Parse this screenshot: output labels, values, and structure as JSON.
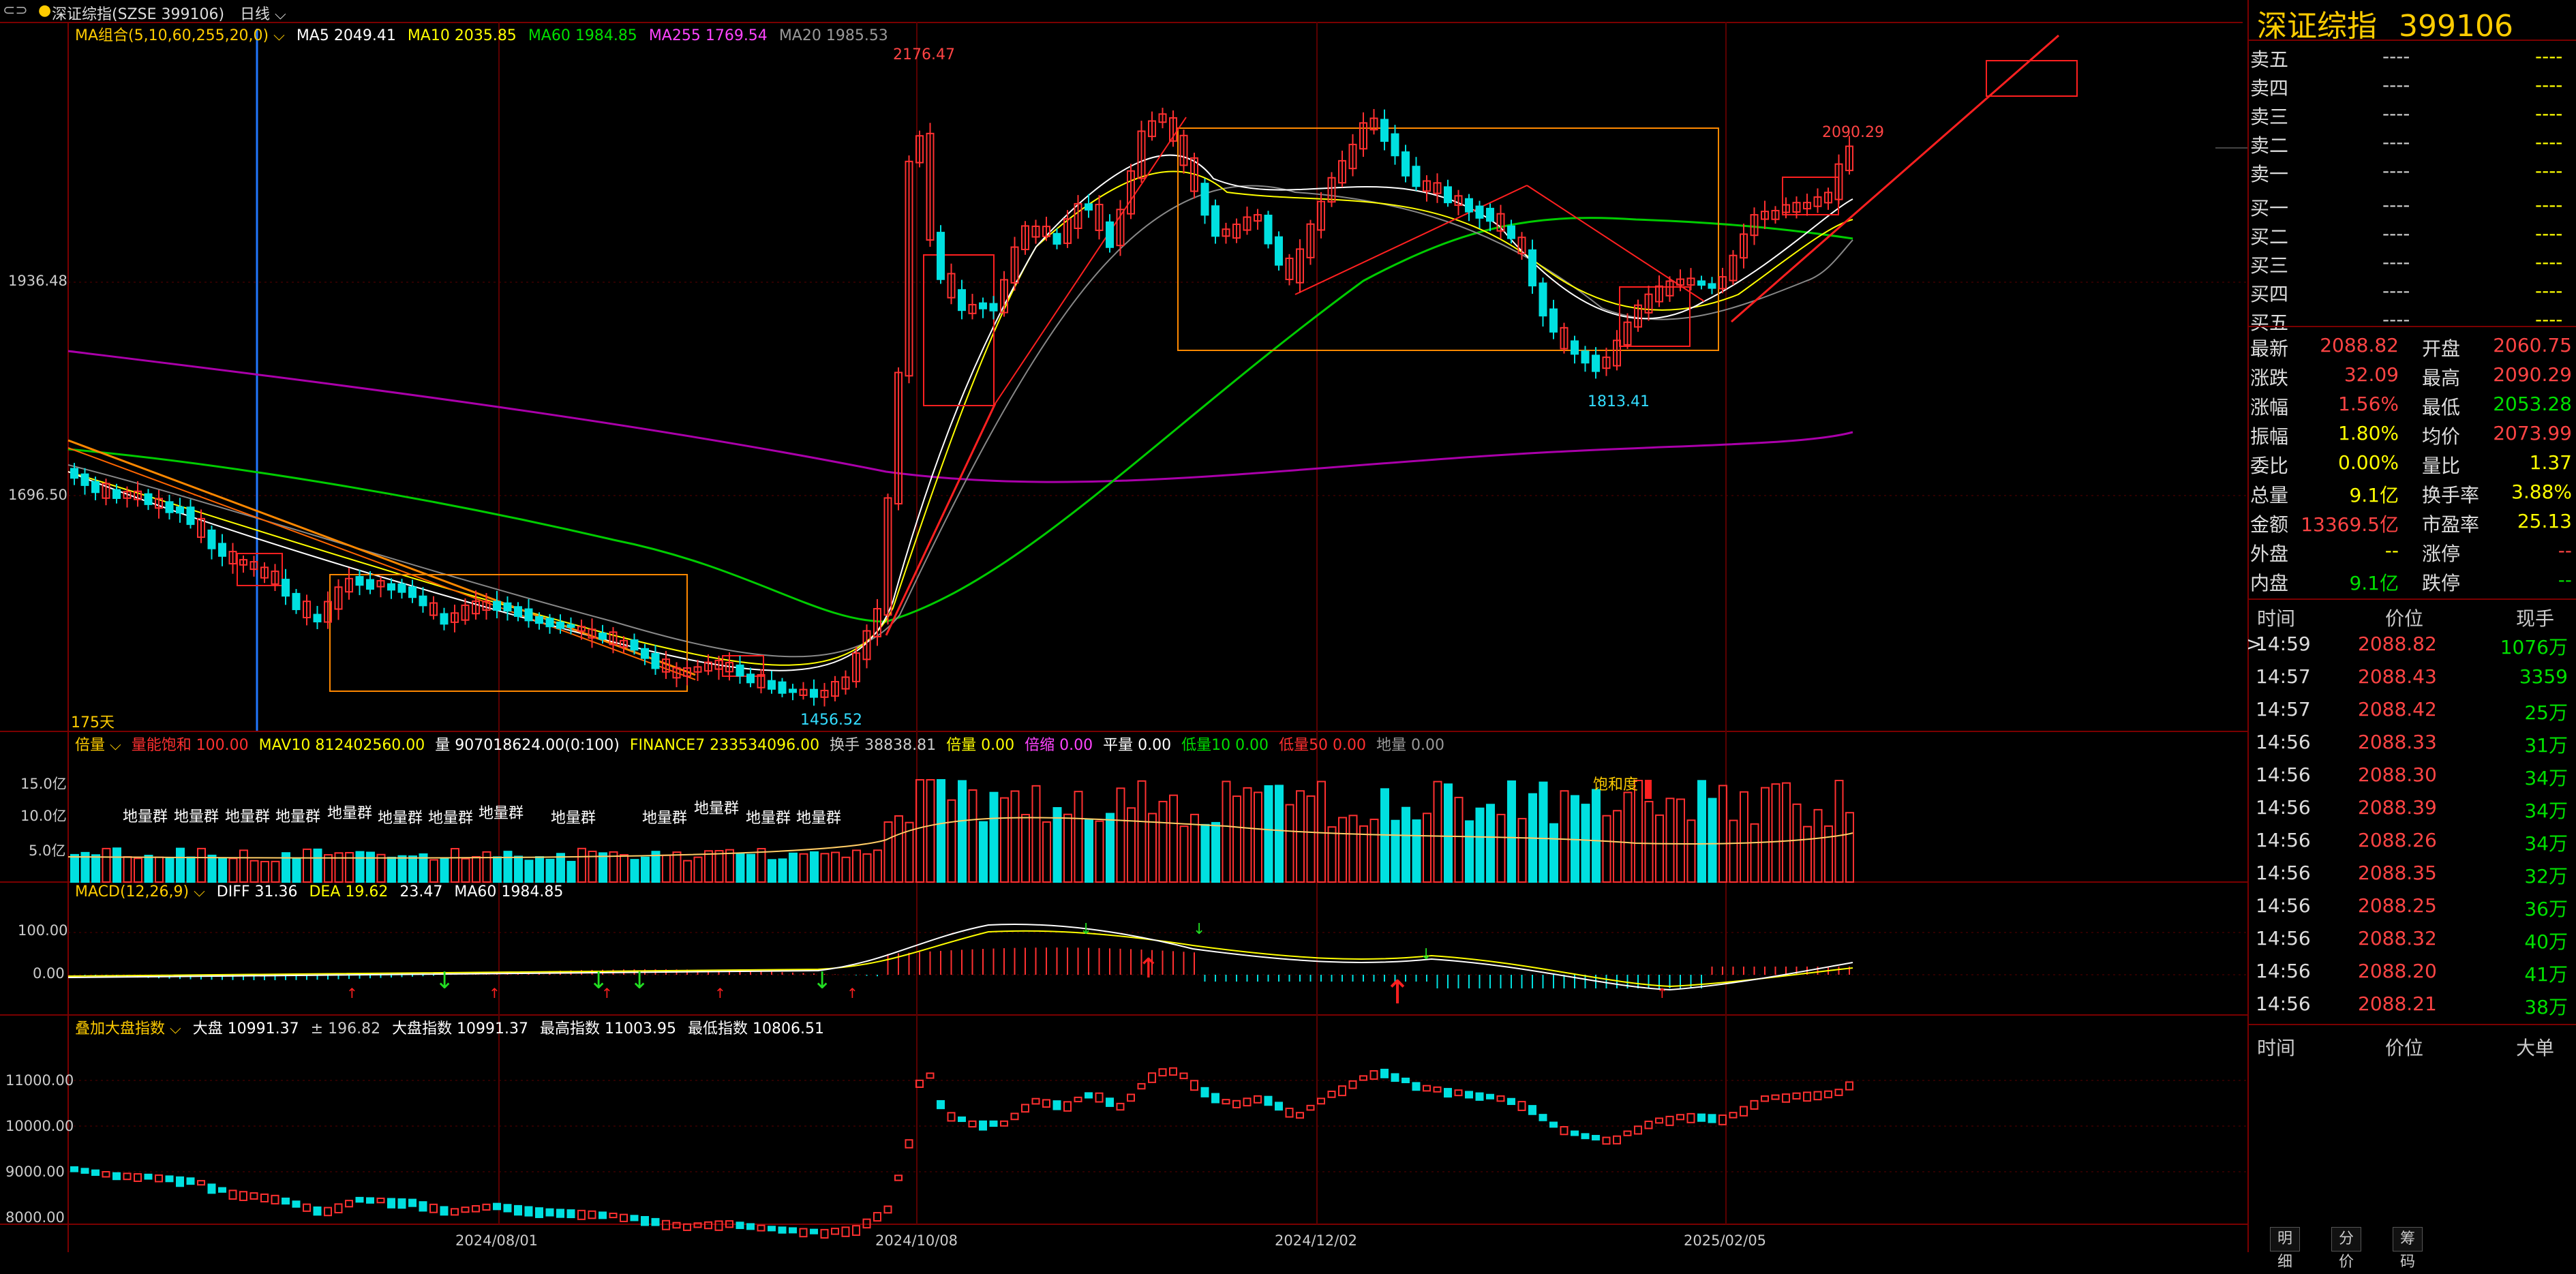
{
  "window": {
    "title": "深证综指(SZSE  399106)",
    "period": "日线"
  },
  "main_legend": {
    "ma_group": "MA组合(5,10,60,255,20,0)",
    "ma5": "MA5 2049.41",
    "ma10": "MA10 2035.85",
    "ma60": "MA60 1984.85",
    "ma255": "MA255 1769.54",
    "ma20": "MA20 1985.53"
  },
  "main_axis": {
    "y1": "1936.48",
    "y2": "1696.50"
  },
  "main_annotations": {
    "high_label": "2176.47",
    "low_label": "1456.52",
    "mid_low_label": "1813.41",
    "last_high_label": "2090.29",
    "days_label": "175天"
  },
  "volume_legend": {
    "name": "倍量",
    "sat": "量能饱和 100.00",
    "mav10": "MAV10 812402560.00",
    "vol": "量 907018624.00(0:100)",
    "finance": "FINANCE7 233534096.00",
    "turnover": "换手 38838.81",
    "double": "倍量 0.00",
    "shrink": "倍缩 0.00",
    "flat": "平量 0.00",
    "low10": "低量10 0.00",
    "low50": "低量50 0.00",
    "ground": "地量 0.00"
  },
  "volume_axis": {
    "y1": "15.0亿",
    "y2": "10.0亿",
    "y3": "5.0亿"
  },
  "volume_annotations": {
    "sat_label": "饱和度",
    "ground_groups": [
      "地量群",
      "地量群",
      "地量群",
      "地量群",
      "地量群",
      "地量群",
      "地量群",
      "地量群",
      "地量群",
      "地量群",
      "地量群",
      "地量群",
      "地量群",
      "地量群"
    ]
  },
  "macd_legend": {
    "name": "MACD(12,26,9)",
    "diff": "DIFF 31.36",
    "dea": "DEA 19.62",
    "macd": "23.47",
    "ma60": "MA60 1984.85"
  },
  "macd_axis": {
    "y1": "100.00",
    "y2": "0.00"
  },
  "index_legend": {
    "name": "叠加大盘指数",
    "dp": "大盘 10991.37",
    "chg": "± 196.82",
    "idx": "大盘指数 10991.37",
    "hi": "最高指数 11003.95",
    "lo": "最低指数 10806.51"
  },
  "index_axis": {
    "y1": "11000.00",
    "y2": "10000.00",
    "y3": "9000.00",
    "y4": "8000.00"
  },
  "x_axis": {
    "d1": "2024/08/01",
    "d2": "2024/10/08",
    "d3": "2024/12/02",
    "d4": "2025/02/05"
  },
  "quote": {
    "name": "深证综指",
    "code": "399106",
    "orderbook": [
      {
        "label": "卖五",
        "price": "----",
        "vol": "----"
      },
      {
        "label": "卖四",
        "price": "----",
        "vol": "----"
      },
      {
        "label": "卖三",
        "price": "----",
        "vol": "----"
      },
      {
        "label": "卖二",
        "price": "----",
        "vol": "----"
      },
      {
        "label": "卖一",
        "price": "----",
        "vol": "----"
      },
      {
        "label": "买一",
        "price": "----",
        "vol": "----"
      },
      {
        "label": "买二",
        "price": "----",
        "vol": "----"
      },
      {
        "label": "买三",
        "price": "----",
        "vol": "----"
      },
      {
        "label": "买四",
        "price": "----",
        "vol": "----"
      },
      {
        "label": "买五",
        "price": "----",
        "vol": "----"
      }
    ],
    "stats": [
      {
        "l1": "最新",
        "v1": "2088.82",
        "c1": "#ff4444",
        "l2": "开盘",
        "v2": "2060.75",
        "c2": "#ff4444"
      },
      {
        "l1": "涨跌",
        "v1": "32.09",
        "c1": "#ff4444",
        "l2": "最高",
        "v2": "2090.29",
        "c2": "#ff4444"
      },
      {
        "l1": "涨幅",
        "v1": "1.56%",
        "c1": "#ff4444",
        "l2": "最低",
        "v2": "2053.28",
        "c2": "#00e000"
      },
      {
        "l1": "振幅",
        "v1": "1.80%",
        "c1": "#ffff00",
        "l2": "均价",
        "v2": "2073.99",
        "c2": "#ff4444"
      },
      {
        "l1": "委比",
        "v1": "0.00%",
        "c1": "#ffff00",
        "l2": "量比",
        "v2": "1.37",
        "c2": "#ffff00"
      },
      {
        "l1": "总量",
        "v1": "9.1亿",
        "c1": "#ffff00",
        "l2": "换手率",
        "v2": "3.88%",
        "c2": "#ffff00"
      },
      {
        "l1": "金额",
        "v1": "13369.5亿",
        "c1": "#ff4444",
        "l2": "市盈率",
        "v2": "25.13",
        "c2": "#ffff00"
      },
      {
        "l1": "外盘",
        "v1": "--",
        "c1": "#ffff00",
        "l2": "涨停",
        "v2": "--",
        "c2": "#ff4444"
      },
      {
        "l1": "内盘",
        "v1": "9.1亿",
        "c1": "#00e000",
        "l2": "跌停",
        "v2": "--",
        "c2": "#00e000"
      }
    ],
    "ticks_header": {
      "time": "时间",
      "price": "价位",
      "vol": "现手"
    },
    "ticks": [
      {
        "time": "14:59",
        "price": "2088.82",
        "vol": "1076万"
      },
      {
        "time": "14:57",
        "price": "2088.43",
        "vol": "3359"
      },
      {
        "time": "14:57",
        "price": "2088.42",
        "vol": "25万"
      },
      {
        "time": "14:56",
        "price": "2088.33",
        "vol": "31万"
      },
      {
        "time": "14:56",
        "price": "2088.30",
        "vol": "34万"
      },
      {
        "time": "14:56",
        "price": "2088.39",
        "vol": "34万"
      },
      {
        "time": "14:56",
        "price": "2088.26",
        "vol": "34万"
      },
      {
        "time": "14:56",
        "price": "2088.35",
        "vol": "32万"
      },
      {
        "time": "14:56",
        "price": "2088.25",
        "vol": "36万"
      },
      {
        "time": "14:56",
        "price": "2088.32",
        "vol": "40万"
      },
      {
        "time": "14:56",
        "price": "2088.20",
        "vol": "41万"
      },
      {
        "time": "14:56",
        "price": "2088.21",
        "vol": "38万"
      }
    ],
    "bigorder_header": {
      "time": "时间",
      "price": "价位",
      "vol": "大单"
    }
  },
  "tabs": [
    "明细",
    "分价",
    "筹码"
  ],
  "colors": {
    "up": "#ff3030",
    "down": "#00e0e0",
    "grid": "#7a0000",
    "ma5": "#ffffff",
    "ma10": "#ffff00",
    "ma60": "#00cc00",
    "ma255": "#cc00cc",
    "ma20": "#999999"
  }
}
